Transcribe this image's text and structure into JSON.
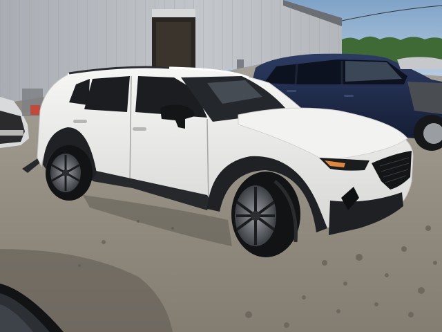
{
  "scene": {
    "sky_color": "#8fb0cf",
    "building_color": "#b9bdc2",
    "ground_color": "#8f8a80",
    "vehicle_white": "#ececea",
    "vehicle_navy": "#1f2b4a",
    "trim_black": "#202224"
  }
}
